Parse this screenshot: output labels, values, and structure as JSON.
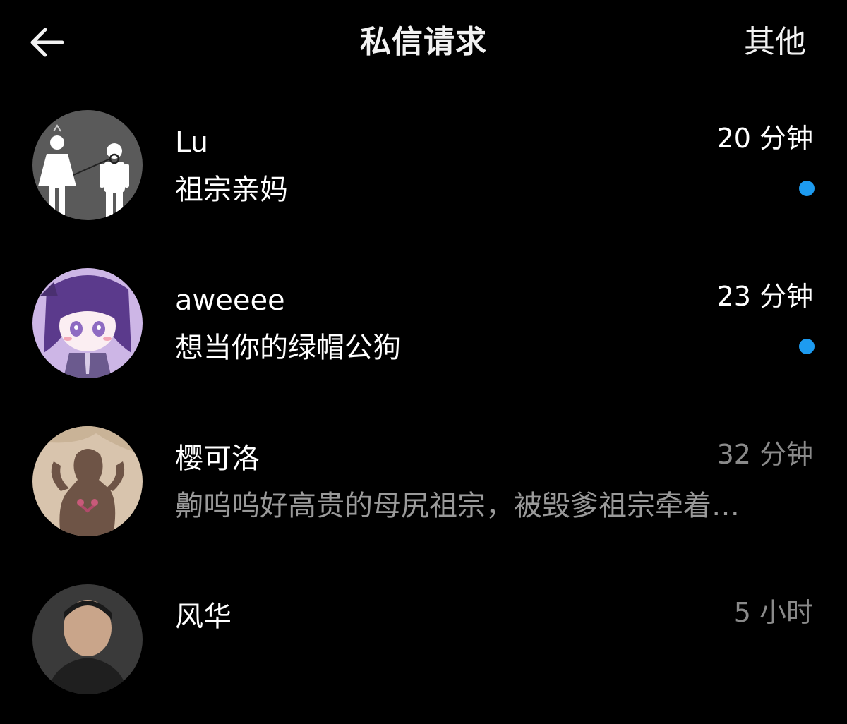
{
  "header": {
    "title": "私信请求",
    "other_label": "其他",
    "back_icon": "arrow-left-icon"
  },
  "colors": {
    "background": "#000000",
    "unread_dot": "#1d9bf0",
    "muted_text": "#9a9a9a"
  },
  "conversations": [
    {
      "name": "Lu",
      "preview": "祖宗亲妈",
      "time": "20 分钟",
      "unread": true,
      "avatar": "restroom-sign-avatar"
    },
    {
      "name": "aweeee",
      "preview": "想当你的绿帽公狗",
      "time": "23 分钟",
      "unread": true,
      "avatar": "anime-girl-avatar"
    },
    {
      "name": "樱可洛",
      "preview": "齁呜呜好高贵的母尻祖宗，被毁爹祖宗牵着…",
      "time": "32 分钟",
      "unread": false,
      "avatar": "silhouette-avatar"
    },
    {
      "name": "风华",
      "preview": "",
      "time": "5 小时",
      "unread": false,
      "avatar": "man-photo-avatar"
    }
  ]
}
